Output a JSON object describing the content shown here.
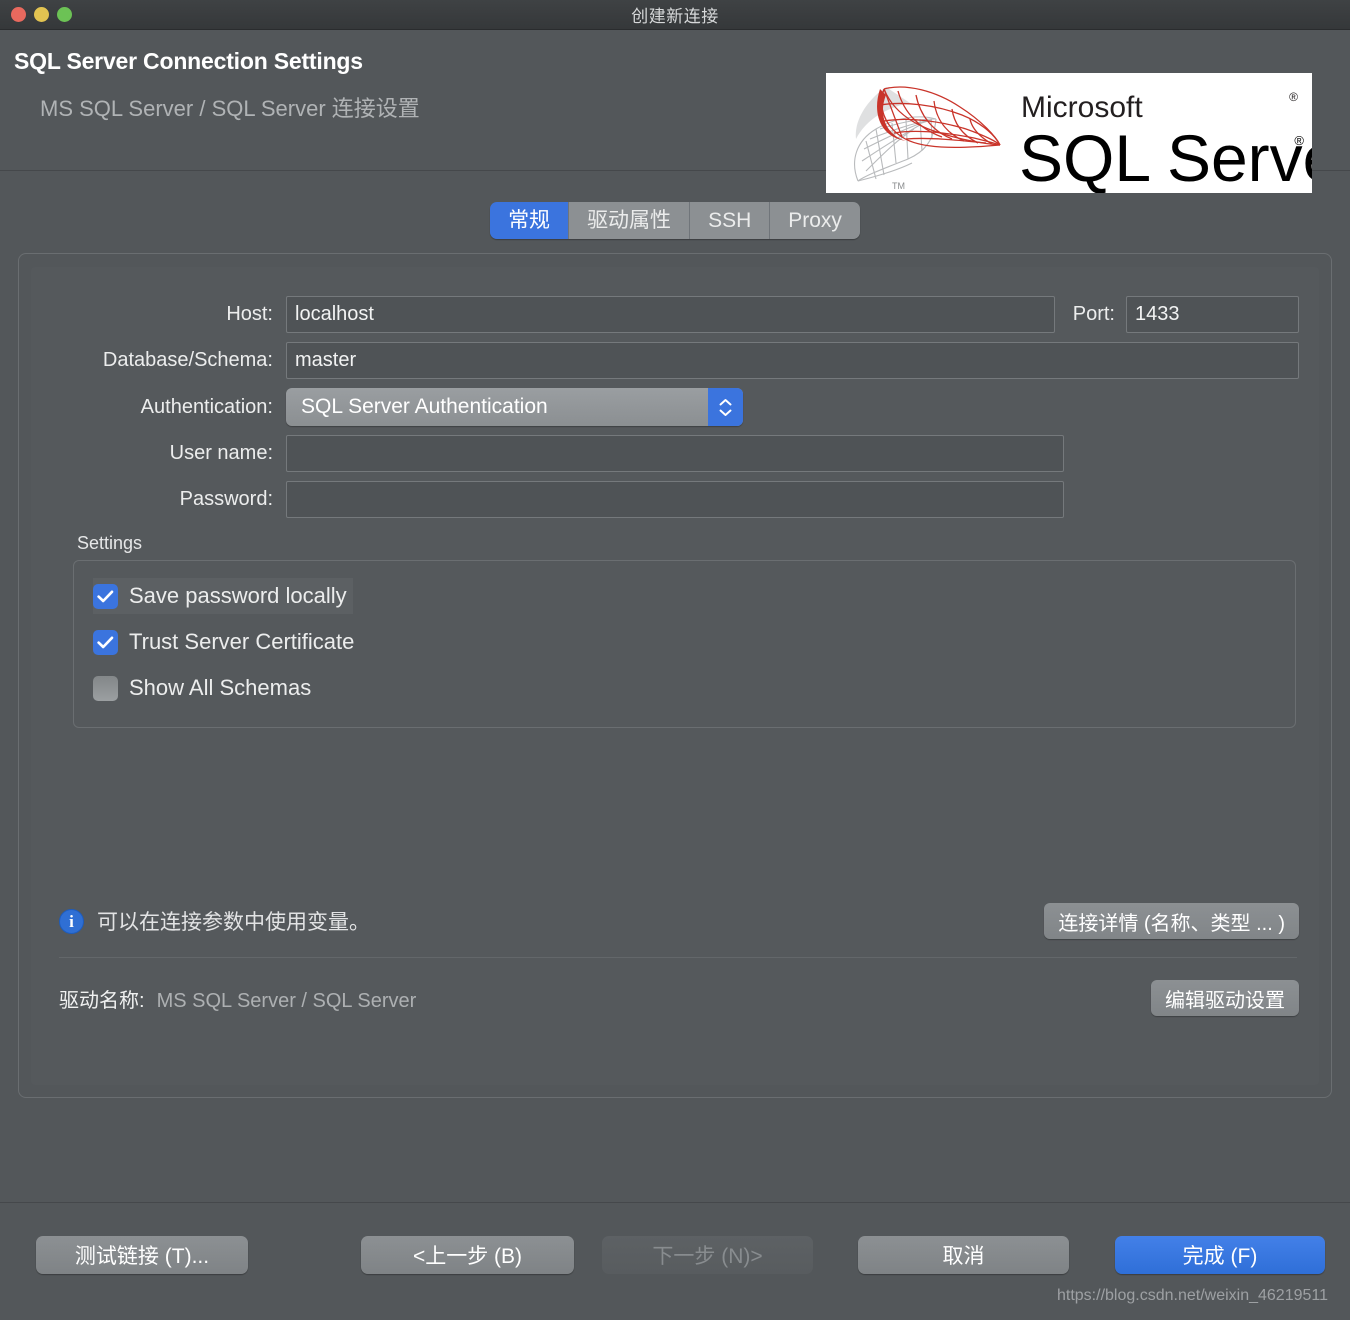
{
  "window": {
    "title": "创建新连接",
    "traffic_lights": [
      "close",
      "minimize",
      "maximize"
    ]
  },
  "header": {
    "title": "SQL Server Connection Settings",
    "subtitle": "MS SQL Server / SQL Server 连接设置",
    "logo": {
      "brand": "Microsoft",
      "product": "SQL Server",
      "trademark": "®",
      "tm": "TM"
    }
  },
  "tabs": [
    {
      "label": "常规",
      "active": true
    },
    {
      "label": "驱动属性",
      "active": false
    },
    {
      "label": "SSH",
      "active": false
    },
    {
      "label": "Proxy",
      "active": false
    }
  ],
  "form": {
    "host_label": "Host:",
    "host_value": "localhost",
    "port_label": "Port:",
    "port_value": "1433",
    "database_label": "Database/Schema:",
    "database_value": "master",
    "auth_label": "Authentication:",
    "auth_value": "SQL Server Authentication",
    "auth_options": [
      "SQL Server Authentication"
    ],
    "username_label": "User name:",
    "username_value": "",
    "username_placeholder": "",
    "password_label": "Password:",
    "password_value": "",
    "password_placeholder": ""
  },
  "settings": {
    "group_title": "Settings",
    "items": [
      {
        "label": "Save password locally",
        "checked": true,
        "focused": true
      },
      {
        "label": "Trust Server Certificate",
        "checked": true,
        "focused": false
      },
      {
        "label": "Show All Schemas",
        "checked": false,
        "focused": false
      }
    ]
  },
  "info": {
    "icon": "info-circle-icon",
    "text": "可以在连接参数中使用变量。",
    "details_button": "连接详情 (名称、类型 ... )"
  },
  "driver": {
    "label": "驱动名称:",
    "value": "MS SQL Server / SQL Server",
    "edit_button": "编辑驱动设置"
  },
  "footer": {
    "test_button": "测试链接 (T)...",
    "prev_button": "<上一步 (B)",
    "next_button": "下一步 (N)>",
    "next_disabled": true,
    "cancel_button": "取消",
    "finish_button": "完成 (F)",
    "watermark": "https://blog.csdn.net/weixin_46219511"
  },
  "colors": {
    "background": "#53575a",
    "accent": "#3b74de",
    "titlebar": "#3a3d3f",
    "text": "#eceded",
    "muted_text": "#b0b3b5",
    "logo_red": "#c9342a"
  }
}
